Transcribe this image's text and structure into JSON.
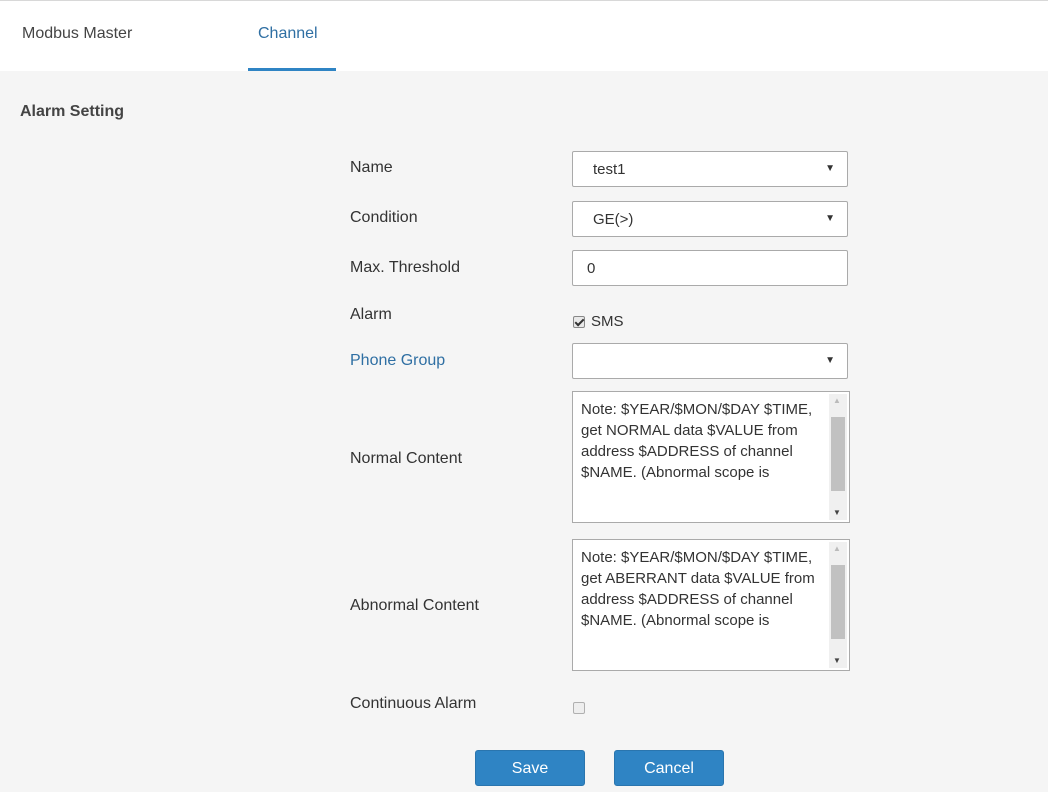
{
  "tabs": [
    {
      "label": "Modbus Master",
      "active": false
    },
    {
      "label": "Channel",
      "active": true
    }
  ],
  "section_title": "Alarm Setting",
  "form": {
    "name": {
      "label": "Name",
      "value": "test1"
    },
    "condition": {
      "label": "Condition",
      "value": "GE(>)"
    },
    "max_threshold": {
      "label": "Max. Threshold",
      "value": "0"
    },
    "alarm": {
      "label": "Alarm",
      "option_label": "SMS",
      "checked": true
    },
    "phone_group": {
      "label": "Phone Group",
      "value": ""
    },
    "normal_content": {
      "label": "Normal Content",
      "text": "Note: $YEAR/$MON/$DAY $TIME, get NORMAL data $VALUE from address $ADDRESS of channel $NAME. (Abnormal scope is"
    },
    "abnormal_content": {
      "label": "Abnormal Content",
      "text": "Note: $YEAR/$MON/$DAY $TIME, get ABERRANT data $VALUE from address $ADDRESS of channel $NAME. (Abnormal scope is"
    },
    "continuous_alarm": {
      "label": "Continuous Alarm",
      "checked": false
    }
  },
  "buttons": {
    "save": "Save",
    "cancel": "Cancel"
  },
  "colors": {
    "accent": "#2f84c4",
    "link": "#2f6fa3",
    "background": "#f5f5f5"
  },
  "icons": {
    "dropdown": "chevron-down-icon",
    "checkbox": "checkbox-icon"
  }
}
